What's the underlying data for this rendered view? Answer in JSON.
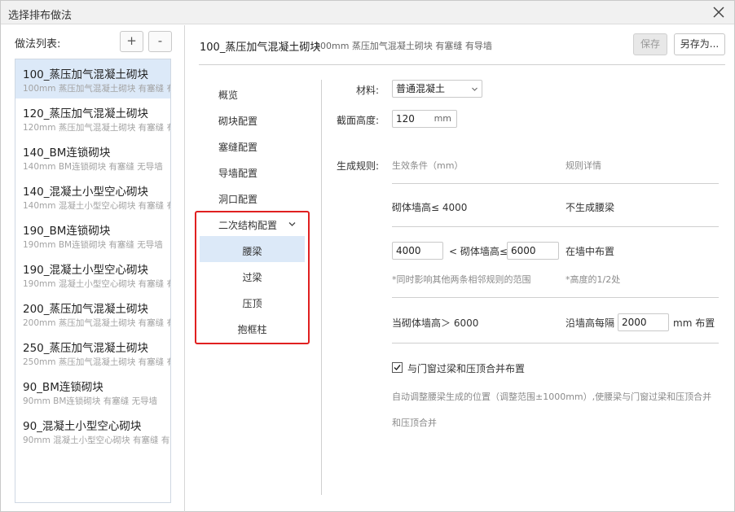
{
  "window": {
    "title": "选择排布做法"
  },
  "left": {
    "header": "做法列表:",
    "add_label": "+",
    "remove_label": "-",
    "items": [
      {
        "name": "100_蒸压加气混凝土砌块",
        "desc": "100mm 蒸压加气混凝土砌块 有塞缝 有",
        "selected": true
      },
      {
        "name": "120_蒸压加气混凝土砌块",
        "desc": "120mm 蒸压加气混凝土砌块 有塞缝 有"
      },
      {
        "name": "140_BM连锁砌块",
        "desc": "140mm BM连锁砌块 有塞缝 无导墙"
      },
      {
        "name": "140_混凝土小型空心砌块",
        "desc": "140mm 混凝土小型空心砌块 有塞缝 有"
      },
      {
        "name": "190_BM连锁砌块",
        "desc": "190mm BM连锁砌块 有塞缝 无导墙"
      },
      {
        "name": "190_混凝土小型空心砌块",
        "desc": "190mm 混凝土小型空心砌块 有塞缝 有"
      },
      {
        "name": "200_蒸压加气混凝土砌块",
        "desc": "200mm 蒸压加气混凝土砌块 有塞缝 有"
      },
      {
        "name": "250_蒸压加气混凝土砌块",
        "desc": "250mm 蒸压加气混凝土砌块 有塞缝 有"
      },
      {
        "name": "90_BM连锁砌块",
        "desc": "90mm BM连锁砌块 有塞缝 无导墙"
      },
      {
        "name": "90_混凝土小型空心砌块",
        "desc": "90mm 混凝土小型空心砌块 有塞缝 有"
      }
    ]
  },
  "header": {
    "name": "100_蒸压加气混凝土砌块",
    "desc": "100mm 蒸压加气混凝土砌块 有塞缝 有导墙",
    "save_label": "保存",
    "saveas_label": "另存为..."
  },
  "nav": {
    "items": [
      "概览",
      "砌块配置",
      "塞缝配置",
      "导墙配置",
      "洞口配置",
      "二次结构配置"
    ],
    "sub_items": [
      "腰梁",
      "过梁",
      "压顶",
      "抱框柱"
    ],
    "selected_sub": "腰梁"
  },
  "form": {
    "material_label": "材料:",
    "material_value": "普通混凝土",
    "section_height_label": "截面高度:",
    "section_height_value": "120",
    "section_height_unit": "mm",
    "rules_label": "生成规则:",
    "col_condition": "生效条件（mm）",
    "col_detail": "规则详情",
    "rule1_condition": "砌体墙高≤ 4000",
    "rule1_detail": "不生成腰梁",
    "rule2_min": "4000",
    "rule2_mid": "< 砌体墙高≤",
    "rule2_max": "6000",
    "rule2_detail": "在墙中布置",
    "rule2_note_left": "*同时影响其他两条相邻规则的范围",
    "rule2_note_right": "*高度的1/2处",
    "rule3_condition": "当砌体墙高＞ 6000",
    "rule3_detail_prefix": "沿墙高每隔",
    "rule3_interval": "2000",
    "rule3_detail_suffix": "mm 布置",
    "merge_checked": true,
    "merge_label": "与门窗过梁和压顶合并布置",
    "merge_desc_line1": "自动调整腰梁生成的位置（调整范围±1000mm）,使腰梁与门窗过梁和压顶合并",
    "merge_desc_line2": "和压顶合并"
  }
}
